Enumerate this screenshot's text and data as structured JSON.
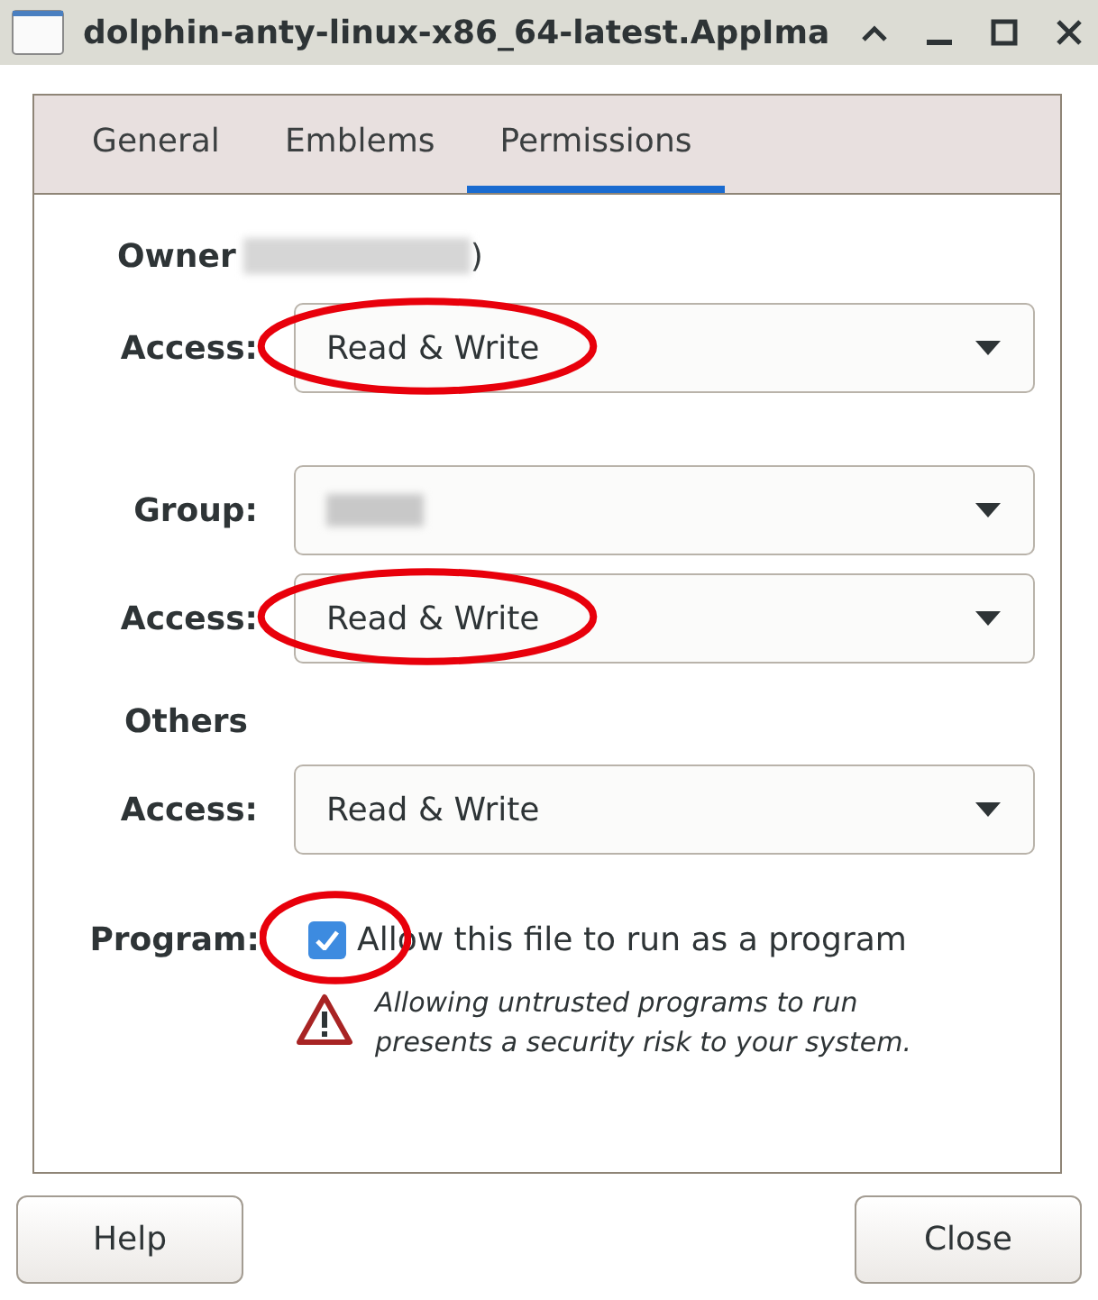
{
  "window": {
    "title": "dolphin-anty-linux-x86_64-latest.AppIma"
  },
  "tabs": [
    {
      "label": "General",
      "selected": false
    },
    {
      "label": "Emblems",
      "selected": false
    },
    {
      "label": "Permissions",
      "selected": true
    }
  ],
  "owner": {
    "heading": "Owner",
    "redacted": true,
    "suffix": ")"
  },
  "rows": [
    {
      "kind": "access",
      "label": "Access:",
      "value": "Read & Write",
      "circled": true
    },
    {
      "kind": "gap"
    },
    {
      "kind": "group",
      "label": "Group:",
      "redacted": true,
      "circled": false
    },
    {
      "kind": "access",
      "label": "Access:",
      "value": "Read & Write",
      "circled": true
    },
    {
      "kind": "heading",
      "label": "Others"
    },
    {
      "kind": "access",
      "label": "Access:",
      "value": "Read & Write",
      "circled": false
    }
  ],
  "program": {
    "label": "Program:",
    "checkbox_label": "Allow this file to run as a program",
    "checked": true,
    "circled": true,
    "warning": "Allowing untrusted programs to run presents a security risk to your system."
  },
  "buttons": [
    {
      "label": "Help"
    },
    {
      "label": "Close"
    }
  ]
}
